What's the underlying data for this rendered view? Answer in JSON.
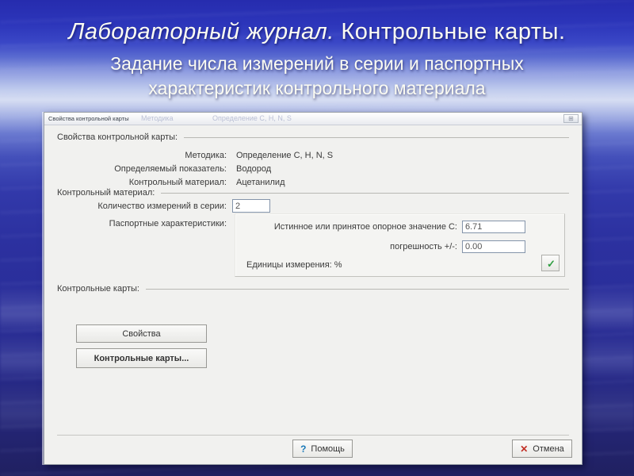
{
  "colors": {
    "slide_top": "#262cae",
    "slide_light_band": "#d6ddf2",
    "slide_bottom": "#202060",
    "help_icon": "#1878b8",
    "cancel_icon": "#c22f25",
    "check_icon": "#2f9e41"
  },
  "slide_title": {
    "line1_italic": "Лабораторный журнал.",
    "line1_rest": " Контрольные карты.",
    "line2": "Задание числа измерений в серии и паспортных характеристик контрольного материала"
  },
  "dialog": {
    "titlebar": {
      "title": "Свойства контрольной карты",
      "ghost1": "Методика",
      "ghost2": "Определение C, H, N, S",
      "window_icon": "⊞"
    },
    "card_props": {
      "header": "Свойства контрольной карты:",
      "rows": [
        {
          "label": "Методика:",
          "value": "Определение C, H, N, S"
        },
        {
          "label": "Определяемый показатель:",
          "value": "Водород"
        },
        {
          "label": "Контрольный материал:",
          "value": "Ацетанилид"
        }
      ]
    },
    "control_material": {
      "header": "Контрольный материал:",
      "series_label": "Количество измерений в серии:",
      "series_value": "2",
      "passport_label": "Паспортные характеристики:",
      "panel": {
        "fields": [
          {
            "label": "Истинное или принятое опорное значение C:",
            "value": "6.71"
          },
          {
            "label": "погрешность +/-:",
            "value": "0.00"
          }
        ],
        "units_label": "Единицы измерения: %",
        "apply_icon": "✓"
      }
    },
    "control_charts": {
      "header": "Контрольные карты:",
      "properties_button": "Свойства",
      "charts_button": "Контрольные карты..."
    },
    "footer": {
      "help_icon": "?",
      "help_label": "Помощь",
      "cancel_icon": "✕",
      "cancel_label": "Отмена"
    }
  }
}
